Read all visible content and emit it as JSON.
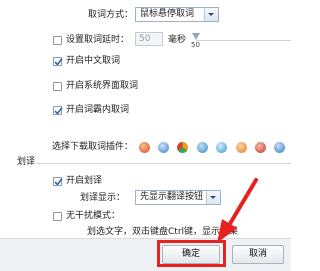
{
  "fetch_mode": {
    "label": "取词方式：",
    "value": "鼠标悬停取词"
  },
  "delay": {
    "label": "设置取词延时：",
    "value": "50",
    "unit": "毫秒",
    "slider_value": "50"
  },
  "options": {
    "chinese": "开启中文取词",
    "system_ui": "开启系统界面取词",
    "word_highlight": "开启词霸内取词"
  },
  "plugins": {
    "label": "选择下载取词插件："
  },
  "translate": {
    "section_title": "划译",
    "enable": "开启划译",
    "display_label": "划译显示：",
    "display_value": "先显示翻译按钮",
    "no_disturb": "无干扰模式：",
    "no_disturb_hint": "划选文字，双击键盘Ctrl键，显示结果"
  },
  "buttons": {
    "ok": "确定",
    "cancel": "取消"
  },
  "colors": {
    "accent_red": "#e8201e",
    "plugin_colors": [
      "#d64b2a",
      "#3d7ec9",
      "#e5a021",
      "#3a89c6",
      "#2f9ad3",
      "#e37a26",
      "#c73c2c",
      "#2f7fc5"
    ]
  }
}
